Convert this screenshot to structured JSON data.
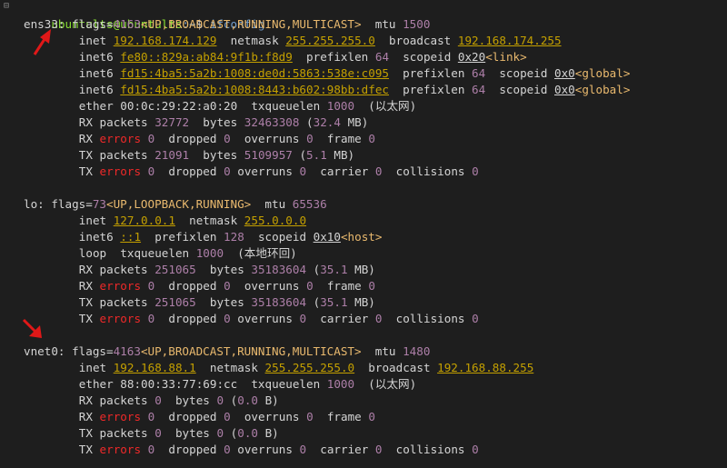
{
  "colors": {
    "background": "#1e1e1e",
    "text": "#d4d4d4",
    "prompt_user": "#8ae234",
    "prompt_path": "#729fcf",
    "number": "#ad7fa8",
    "ip": "#c4a000",
    "error": "#ef2929",
    "angle": "#e9b96e",
    "arrow": "#e01818"
  },
  "terminal": {
    "prompt": {
      "user_host": "ubuntults@ubuntults",
      "path": ":~",
      "symbol": "$",
      "command": "ifconfig"
    },
    "lines": [
      {
        "indent": 0,
        "segs": [
          [
            "iface",
            "ens33"
          ],
          [
            "t",
            ": flags="
          ],
          [
            "n",
            "4163"
          ],
          [
            "a",
            "<UP,BROADCAST,RUNNING,MULTICAST>"
          ],
          [
            "t",
            "  mtu "
          ],
          [
            "n",
            "1500"
          ]
        ]
      },
      {
        "indent": 8,
        "segs": [
          [
            "t",
            "inet "
          ],
          [
            "ip",
            "192.168.174.129"
          ],
          [
            "t",
            "  netmask "
          ],
          [
            "ip",
            "255.255.255.0"
          ],
          [
            "t",
            "  broadcast "
          ],
          [
            "ip",
            "192.168.174.255"
          ]
        ]
      },
      {
        "indent": 8,
        "segs": [
          [
            "t",
            "inet6 "
          ],
          [
            "ip",
            "fe80::829a:ab84:9f1b:f8d9"
          ],
          [
            "t",
            "  prefixlen "
          ],
          [
            "n",
            "64"
          ],
          [
            "t",
            "  scopeid "
          ],
          [
            "u",
            "0x20"
          ],
          [
            "a",
            "<link>"
          ]
        ]
      },
      {
        "indent": 8,
        "segs": [
          [
            "t",
            "inet6 "
          ],
          [
            "ip",
            "fd15:4ba5:5a2b:1008:de0d:5863:538e:c095"
          ],
          [
            "t",
            "  prefixlen "
          ],
          [
            "n",
            "64"
          ],
          [
            "t",
            "  scopeid "
          ],
          [
            "u",
            "0x0"
          ],
          [
            "a",
            "<global>"
          ]
        ]
      },
      {
        "indent": 8,
        "segs": [
          [
            "t",
            "inet6 "
          ],
          [
            "ip",
            "fd15:4ba5:5a2b:1008:8443:b602:98bb:dfec"
          ],
          [
            "t",
            "  prefixlen "
          ],
          [
            "n",
            "64"
          ],
          [
            "t",
            "  scopeid "
          ],
          [
            "u",
            "0x0"
          ],
          [
            "a",
            "<global>"
          ]
        ]
      },
      {
        "indent": 8,
        "segs": [
          [
            "t",
            "ether 00:0c:29:22:a0:20  txqueuelen "
          ],
          [
            "n",
            "1000"
          ],
          [
            "t",
            "  (以太网)"
          ]
        ]
      },
      {
        "indent": 8,
        "segs": [
          [
            "t",
            "RX packets "
          ],
          [
            "n",
            "32772"
          ],
          [
            "t",
            "  bytes "
          ],
          [
            "n",
            "32463308"
          ],
          [
            "t",
            " ("
          ],
          [
            "n",
            "32.4"
          ],
          [
            "t",
            " MB)"
          ]
        ]
      },
      {
        "indent": 8,
        "segs": [
          [
            "t",
            "RX "
          ],
          [
            "e",
            "errors"
          ],
          [
            "t",
            " "
          ],
          [
            "n",
            "0"
          ],
          [
            "t",
            "  dropped "
          ],
          [
            "n",
            "0"
          ],
          [
            "t",
            "  overruns "
          ],
          [
            "n",
            "0"
          ],
          [
            "t",
            "  frame "
          ],
          [
            "n",
            "0"
          ]
        ]
      },
      {
        "indent": 8,
        "segs": [
          [
            "t",
            "TX packets "
          ],
          [
            "n",
            "21091"
          ],
          [
            "t",
            "  bytes "
          ],
          [
            "n",
            "5109957"
          ],
          [
            "t",
            " ("
          ],
          [
            "n",
            "5.1"
          ],
          [
            "t",
            " MB)"
          ]
        ]
      },
      {
        "indent": 8,
        "segs": [
          [
            "t",
            "TX "
          ],
          [
            "e",
            "errors"
          ],
          [
            "t",
            " "
          ],
          [
            "n",
            "0"
          ],
          [
            "t",
            "  dropped "
          ],
          [
            "n",
            "0"
          ],
          [
            "t",
            " overruns "
          ],
          [
            "n",
            "0"
          ],
          [
            "t",
            "  carrier "
          ],
          [
            "n",
            "0"
          ],
          [
            "t",
            "  collisions "
          ],
          [
            "n",
            "0"
          ]
        ]
      },
      {
        "indent": 0,
        "segs": []
      },
      {
        "indent": 0,
        "segs": [
          [
            "iface",
            "lo"
          ],
          [
            "t",
            ": flags="
          ],
          [
            "n",
            "73"
          ],
          [
            "a",
            "<UP,LOOPBACK,RUNNING>"
          ],
          [
            "t",
            "  mtu "
          ],
          [
            "n",
            "65536"
          ]
        ]
      },
      {
        "indent": 8,
        "segs": [
          [
            "t",
            "inet "
          ],
          [
            "ip",
            "127.0.0.1"
          ],
          [
            "t",
            "  netmask "
          ],
          [
            "ip",
            "255.0.0.0"
          ]
        ]
      },
      {
        "indent": 8,
        "segs": [
          [
            "t",
            "inet6 "
          ],
          [
            "ip",
            "::1"
          ],
          [
            "t",
            "  prefixlen "
          ],
          [
            "n",
            "128"
          ],
          [
            "t",
            "  scopeid "
          ],
          [
            "u",
            "0x10"
          ],
          [
            "a",
            "<host>"
          ]
        ]
      },
      {
        "indent": 8,
        "segs": [
          [
            "t",
            "loop  txqueuelen "
          ],
          [
            "n",
            "1000"
          ],
          [
            "t",
            "  (本地环回)"
          ]
        ]
      },
      {
        "indent": 8,
        "segs": [
          [
            "t",
            "RX packets "
          ],
          [
            "n",
            "251065"
          ],
          [
            "t",
            "  bytes "
          ],
          [
            "n",
            "35183604"
          ],
          [
            "t",
            " ("
          ],
          [
            "n",
            "35.1"
          ],
          [
            "t",
            " MB)"
          ]
        ]
      },
      {
        "indent": 8,
        "segs": [
          [
            "t",
            "RX "
          ],
          [
            "e",
            "errors"
          ],
          [
            "t",
            " "
          ],
          [
            "n",
            "0"
          ],
          [
            "t",
            "  dropped "
          ],
          [
            "n",
            "0"
          ],
          [
            "t",
            "  overruns "
          ],
          [
            "n",
            "0"
          ],
          [
            "t",
            "  frame "
          ],
          [
            "n",
            "0"
          ]
        ]
      },
      {
        "indent": 8,
        "segs": [
          [
            "t",
            "TX packets "
          ],
          [
            "n",
            "251065"
          ],
          [
            "t",
            "  bytes "
          ],
          [
            "n",
            "35183604"
          ],
          [
            "t",
            " ("
          ],
          [
            "n",
            "35.1"
          ],
          [
            "t",
            " MB)"
          ]
        ]
      },
      {
        "indent": 8,
        "segs": [
          [
            "t",
            "TX "
          ],
          [
            "e",
            "errors"
          ],
          [
            "t",
            " "
          ],
          [
            "n",
            "0"
          ],
          [
            "t",
            "  dropped "
          ],
          [
            "n",
            "0"
          ],
          [
            "t",
            " overruns "
          ],
          [
            "n",
            "0"
          ],
          [
            "t",
            "  carrier "
          ],
          [
            "n",
            "0"
          ],
          [
            "t",
            "  collisions "
          ],
          [
            "n",
            "0"
          ]
        ]
      },
      {
        "indent": 0,
        "segs": []
      },
      {
        "indent": 0,
        "segs": [
          [
            "iface",
            "vnet0"
          ],
          [
            "t",
            ": flags="
          ],
          [
            "n",
            "4163"
          ],
          [
            "a",
            "<UP,BROADCAST,RUNNING,MULTICAST>"
          ],
          [
            "t",
            "  mtu "
          ],
          [
            "n",
            "1480"
          ]
        ]
      },
      {
        "indent": 8,
        "segs": [
          [
            "t",
            "inet "
          ],
          [
            "ip",
            "192.168.88.1"
          ],
          [
            "t",
            "  netmask "
          ],
          [
            "ip",
            "255.255.255.0"
          ],
          [
            "t",
            "  broadcast "
          ],
          [
            "ip",
            "192.168.88.255"
          ]
        ]
      },
      {
        "indent": 8,
        "segs": [
          [
            "t",
            "ether 88:00:33:77:69:cc  txqueuelen "
          ],
          [
            "n",
            "1000"
          ],
          [
            "t",
            "  (以太网)"
          ]
        ]
      },
      {
        "indent": 8,
        "segs": [
          [
            "t",
            "RX packets "
          ],
          [
            "n",
            "0"
          ],
          [
            "t",
            "  bytes "
          ],
          [
            "n",
            "0"
          ],
          [
            "t",
            " ("
          ],
          [
            "n",
            "0.0"
          ],
          [
            "t",
            " B)"
          ]
        ]
      },
      {
        "indent": 8,
        "segs": [
          [
            "t",
            "RX "
          ],
          [
            "e",
            "errors"
          ],
          [
            "t",
            " "
          ],
          [
            "n",
            "0"
          ],
          [
            "t",
            "  dropped "
          ],
          [
            "n",
            "0"
          ],
          [
            "t",
            "  overruns "
          ],
          [
            "n",
            "0"
          ],
          [
            "t",
            "  frame "
          ],
          [
            "n",
            "0"
          ]
        ]
      },
      {
        "indent": 8,
        "segs": [
          [
            "t",
            "TX packets "
          ],
          [
            "n",
            "0"
          ],
          [
            "t",
            "  bytes "
          ],
          [
            "n",
            "0"
          ],
          [
            "t",
            " ("
          ],
          [
            "n",
            "0.0"
          ],
          [
            "t",
            " B)"
          ]
        ]
      },
      {
        "indent": 8,
        "segs": [
          [
            "t",
            "TX "
          ],
          [
            "e",
            "errors"
          ],
          [
            "t",
            " "
          ],
          [
            "n",
            "0"
          ],
          [
            "t",
            "  dropped "
          ],
          [
            "n",
            "0"
          ],
          [
            "t",
            " overruns "
          ],
          [
            "n",
            "0"
          ],
          [
            "t",
            "  carrier "
          ],
          [
            "n",
            "0"
          ],
          [
            "t",
            "  collisions "
          ],
          [
            "n",
            "0"
          ]
        ]
      }
    ]
  }
}
